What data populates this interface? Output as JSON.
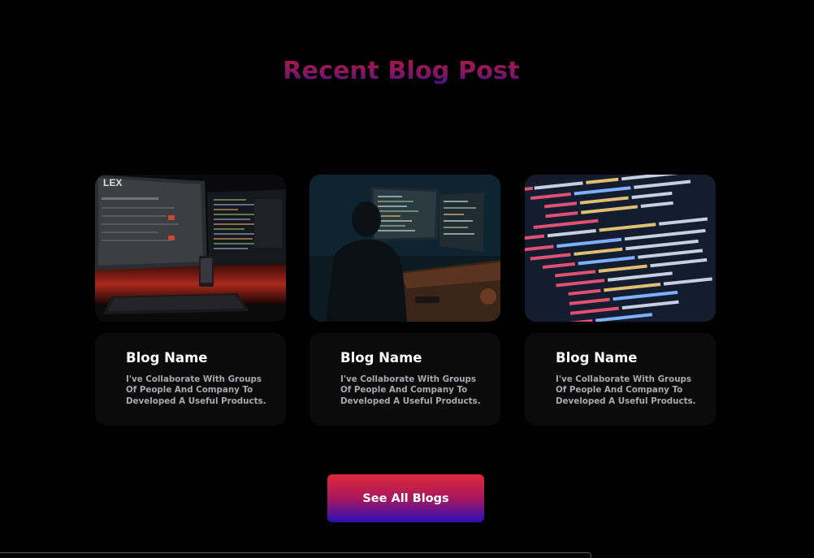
{
  "section": {
    "title": "Recent Blog Post"
  },
  "colors": {
    "background": "#000000",
    "title_gradient": [
      "#b0154f",
      "#3d1288"
    ],
    "button_gradient": [
      "#e0293a",
      "#a8185e",
      "#2a0fb8"
    ],
    "card_background": "#0b0b0c"
  },
  "posts": [
    {
      "image": "desk-monitors-red-light-photo",
      "name": "Blog Name",
      "description": "I've Collaborate With Groups Of People And Company To Developed A Useful Products."
    },
    {
      "image": "developer-at-desk-photo",
      "name": "Blog Name",
      "description": "I've Collaborate With Groups Of People And Company To Developed A Useful Products."
    },
    {
      "image": "code-on-screen-photo",
      "name": "Blog Name",
      "description": "I've Collaborate With Groups Of People And Company To Developed A Useful Products."
    }
  ],
  "actions": {
    "see_all_label": "See All Blogs"
  }
}
